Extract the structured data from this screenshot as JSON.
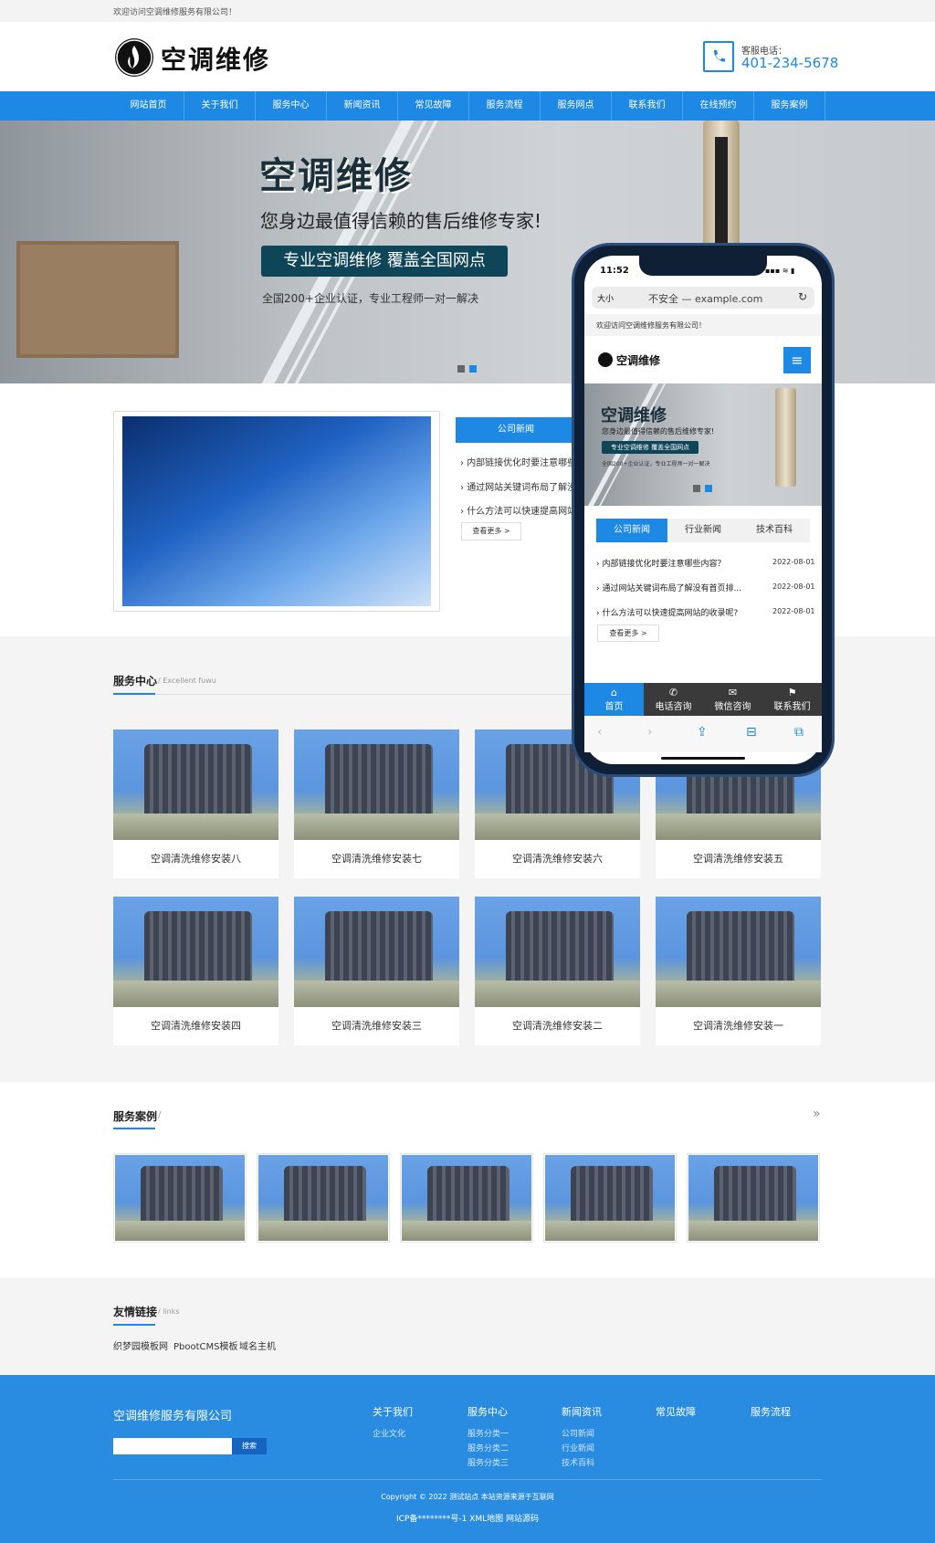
{
  "topbar": {
    "welcome": "欢迎访问空调维修服务有限公司！"
  },
  "header": {
    "logo_text": "空调维修",
    "phone_label": "客服电话：",
    "phone_number": "401-234-5678"
  },
  "nav": {
    "items": [
      "网站首页",
      "关于我们",
      "服务中心",
      "新闻资讯",
      "常见故障",
      "服务流程",
      "服务网点",
      "联系我们",
      "在线预约",
      "服务案例"
    ]
  },
  "banner": {
    "title": "空调维修",
    "subtitle": "您身边最值得信赖的售后维修专家!",
    "pill": "专业空调维修  覆盖全国网点",
    "small": "全国200+企业认证，专业工程师一对一解决"
  },
  "news": {
    "tab_label": "公司新闻",
    "items": [
      "内部链接优化时要注意哪些内容？",
      "通过网站关键词布局了解没有首页排名原因",
      "什么方法可以快速提高网站的收录呢？"
    ],
    "items_visible": [
      "内部链接优化时要注意哪些",
      "通过网站关键词布局了解没",
      "什么方法可以快速提高网站"
    ],
    "more": "查看更多 >"
  },
  "services": {
    "title": "服务中心",
    "subtitle": "/ Excellent fuwu",
    "cards": [
      "空调清洗维修安装八",
      "空调清洗维修安装七",
      "空调清洗维修安装六",
      "空调清洗维修安装五",
      "空调清洗维修安装四",
      "空调清洗维修安装三",
      "空调清洗维修安装二",
      "空调清洗维修安装一"
    ]
  },
  "cases": {
    "title": "服务案例",
    "slash": "/",
    "arrow": "»"
  },
  "links": {
    "title": "友情链接",
    "subtitle": "/ links",
    "items": [
      "织梦园模板网",
      "PbootCMS模板",
      "域名主机"
    ]
  },
  "footer": {
    "company": "空调维修服务有限公司",
    "search_button": "搜索",
    "columns": [
      {
        "title": "关于我们",
        "links": [
          "企业文化"
        ]
      },
      {
        "title": "服务中心",
        "links": [
          "服务分类一",
          "服务分类二",
          "服务分类三"
        ]
      },
      {
        "title": "新闻资讯",
        "links": [
          "公司新闻",
          "行业新闻",
          "技术百科"
        ]
      },
      {
        "title": "常见故障",
        "links": []
      },
      {
        "title": "服务流程",
        "links": []
      }
    ],
    "copyright": "Copyright © 2022 测试站点 本站资源来源于互联网",
    "icp": "ICP备********号-1 XML地图 网站源码"
  },
  "phone_mockup": {
    "time": "11:52",
    "status": "▪▪▪ ≋ ▮",
    "url_aa": "大小",
    "url_text": "不安全 — example.com",
    "welcome": "欢迎访问空调维修服务有限公司！",
    "logo_text": "空调维修",
    "menu_icon": "≡",
    "banner_title": "空调维修",
    "banner_sub": "您身边最值得信赖的售后维修专家!",
    "banner_pill": "专业空调维修  覆盖全国网点",
    "banner_small": "全国200+企业认证，专业工程师一对一解决",
    "tabs": [
      "公司新闻",
      "行业新闻",
      "技术百科"
    ],
    "news": [
      {
        "title": "内部链接优化时要注意哪些内容？",
        "date": "2022-08-01"
      },
      {
        "title": "通过网站关键词布局了解没有首页排...",
        "date": "2022-08-01"
      },
      {
        "title": "什么方法可以快速提高网站的收录呢?",
        "date": "2022-08-01"
      }
    ],
    "more": "查看更多 >",
    "bottom_nav": [
      {
        "icon": "⌂",
        "label": "首页"
      },
      {
        "icon": "✆",
        "label": "电话咨询"
      },
      {
        "icon": "✉",
        "label": "微信咨询"
      },
      {
        "icon": "⚑",
        "label": "联系我们"
      }
    ],
    "safari": [
      "‹",
      "›",
      "⇪",
      "⊟",
      "⧉"
    ]
  },
  "colors": {
    "brand": "#1e88e5",
    "footer": "#2a8ce0",
    "dark_teal": "#0e4558"
  }
}
